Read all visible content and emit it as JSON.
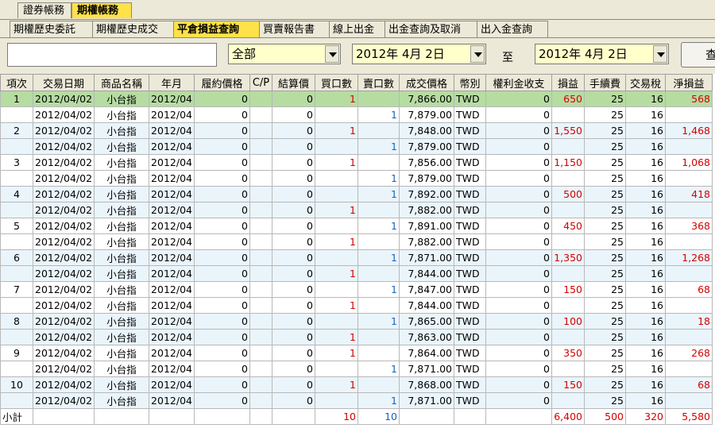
{
  "top_tabs": [
    "證券帳務",
    "期權帳務"
  ],
  "active_top_tab": 1,
  "sub_tabs": [
    "期權歷史委託",
    "期權歷史成交",
    "平倉損益查詢",
    "買賣報告書",
    "線上出金",
    "出金查詢及取消",
    "出入金查詢"
  ],
  "active_sub_tab": 2,
  "filter": {
    "text_value": "",
    "category": "全部",
    "from_date": "2012年 4月 2日",
    "to_label": "至",
    "to_date": "2012年 4月 2日",
    "query_button": "查"
  },
  "columns": [
    "項次",
    "交易日期",
    "商品名稱",
    "年月",
    "履約價格",
    "C/P",
    "結算價",
    "買口數",
    "賣口數",
    "成交價格",
    "幣別",
    "權利金收支",
    "損益",
    "手續費",
    "交易稅",
    "淨損益"
  ],
  "rows": [
    {
      "item": "1",
      "date": "2012/04/02",
      "product": "小台指",
      "ym": "2012/04",
      "strike": "0",
      "cp": "",
      "settle": "0",
      "buy": "1",
      "sell": "",
      "price": "7,866.00",
      "cur": "TWD",
      "premium": "0",
      "pl": "650",
      "fee": "25",
      "tax": "16",
      "net": "568"
    },
    {
      "item": "",
      "date": "2012/04/02",
      "product": "小台指",
      "ym": "2012/04",
      "strike": "0",
      "cp": "",
      "settle": "0",
      "buy": "",
      "sell": "1",
      "price": "7,879.00",
      "cur": "TWD",
      "premium": "0",
      "pl": "",
      "fee": "25",
      "tax": "16",
      "net": ""
    },
    {
      "item": "2",
      "date": "2012/04/02",
      "product": "小台指",
      "ym": "2012/04",
      "strike": "0",
      "cp": "",
      "settle": "0",
      "buy": "1",
      "sell": "",
      "price": "7,848.00",
      "cur": "TWD",
      "premium": "0",
      "pl": "1,550",
      "fee": "25",
      "tax": "16",
      "net": "1,468"
    },
    {
      "item": "",
      "date": "2012/04/02",
      "product": "小台指",
      "ym": "2012/04",
      "strike": "0",
      "cp": "",
      "settle": "0",
      "buy": "",
      "sell": "1",
      "price": "7,879.00",
      "cur": "TWD",
      "premium": "0",
      "pl": "",
      "fee": "25",
      "tax": "16",
      "net": ""
    },
    {
      "item": "3",
      "date": "2012/04/02",
      "product": "小台指",
      "ym": "2012/04",
      "strike": "0",
      "cp": "",
      "settle": "0",
      "buy": "1",
      "sell": "",
      "price": "7,856.00",
      "cur": "TWD",
      "premium": "0",
      "pl": "1,150",
      "fee": "25",
      "tax": "16",
      "net": "1,068"
    },
    {
      "item": "",
      "date": "2012/04/02",
      "product": "小台指",
      "ym": "2012/04",
      "strike": "0",
      "cp": "",
      "settle": "0",
      "buy": "",
      "sell": "1",
      "price": "7,879.00",
      "cur": "TWD",
      "premium": "0",
      "pl": "",
      "fee": "25",
      "tax": "16",
      "net": ""
    },
    {
      "item": "4",
      "date": "2012/04/02",
      "product": "小台指",
      "ym": "2012/04",
      "strike": "0",
      "cp": "",
      "settle": "0",
      "buy": "",
      "sell": "1",
      "price": "7,892.00",
      "cur": "TWD",
      "premium": "0",
      "pl": "500",
      "fee": "25",
      "tax": "16",
      "net": "418"
    },
    {
      "item": "",
      "date": "2012/04/02",
      "product": "小台指",
      "ym": "2012/04",
      "strike": "0",
      "cp": "",
      "settle": "0",
      "buy": "1",
      "sell": "",
      "price": "7,882.00",
      "cur": "TWD",
      "premium": "0",
      "pl": "",
      "fee": "25",
      "tax": "16",
      "net": ""
    },
    {
      "item": "5",
      "date": "2012/04/02",
      "product": "小台指",
      "ym": "2012/04",
      "strike": "0",
      "cp": "",
      "settle": "0",
      "buy": "",
      "sell": "1",
      "price": "7,891.00",
      "cur": "TWD",
      "premium": "0",
      "pl": "450",
      "fee": "25",
      "tax": "16",
      "net": "368"
    },
    {
      "item": "",
      "date": "2012/04/02",
      "product": "小台指",
      "ym": "2012/04",
      "strike": "0",
      "cp": "",
      "settle": "0",
      "buy": "1",
      "sell": "",
      "price": "7,882.00",
      "cur": "TWD",
      "premium": "0",
      "pl": "",
      "fee": "25",
      "tax": "16",
      "net": ""
    },
    {
      "item": "6",
      "date": "2012/04/02",
      "product": "小台指",
      "ym": "2012/04",
      "strike": "0",
      "cp": "",
      "settle": "0",
      "buy": "",
      "sell": "1",
      "price": "7,871.00",
      "cur": "TWD",
      "premium": "0",
      "pl": "1,350",
      "fee": "25",
      "tax": "16",
      "net": "1,268"
    },
    {
      "item": "",
      "date": "2012/04/02",
      "product": "小台指",
      "ym": "2012/04",
      "strike": "0",
      "cp": "",
      "settle": "0",
      "buy": "1",
      "sell": "",
      "price": "7,844.00",
      "cur": "TWD",
      "premium": "0",
      "pl": "",
      "fee": "25",
      "tax": "16",
      "net": ""
    },
    {
      "item": "7",
      "date": "2012/04/02",
      "product": "小台指",
      "ym": "2012/04",
      "strike": "0",
      "cp": "",
      "settle": "0",
      "buy": "",
      "sell": "1",
      "price": "7,847.00",
      "cur": "TWD",
      "premium": "0",
      "pl": "150",
      "fee": "25",
      "tax": "16",
      "net": "68"
    },
    {
      "item": "",
      "date": "2012/04/02",
      "product": "小台指",
      "ym": "2012/04",
      "strike": "0",
      "cp": "",
      "settle": "0",
      "buy": "1",
      "sell": "",
      "price": "7,844.00",
      "cur": "TWD",
      "premium": "0",
      "pl": "",
      "fee": "25",
      "tax": "16",
      "net": ""
    },
    {
      "item": "8",
      "date": "2012/04/02",
      "product": "小台指",
      "ym": "2012/04",
      "strike": "0",
      "cp": "",
      "settle": "0",
      "buy": "",
      "sell": "1",
      "price": "7,865.00",
      "cur": "TWD",
      "premium": "0",
      "pl": "100",
      "fee": "25",
      "tax": "16",
      "net": "18"
    },
    {
      "item": "",
      "date": "2012/04/02",
      "product": "小台指",
      "ym": "2012/04",
      "strike": "0",
      "cp": "",
      "settle": "0",
      "buy": "1",
      "sell": "",
      "price": "7,863.00",
      "cur": "TWD",
      "premium": "0",
      "pl": "",
      "fee": "25",
      "tax": "16",
      "net": ""
    },
    {
      "item": "9",
      "date": "2012/04/02",
      "product": "小台指",
      "ym": "2012/04",
      "strike": "0",
      "cp": "",
      "settle": "0",
      "buy": "1",
      "sell": "",
      "price": "7,864.00",
      "cur": "TWD",
      "premium": "0",
      "pl": "350",
      "fee": "25",
      "tax": "16",
      "net": "268"
    },
    {
      "item": "",
      "date": "2012/04/02",
      "product": "小台指",
      "ym": "2012/04",
      "strike": "0",
      "cp": "",
      "settle": "0",
      "buy": "",
      "sell": "1",
      "price": "7,871.00",
      "cur": "TWD",
      "premium": "0",
      "pl": "",
      "fee": "25",
      "tax": "16",
      "net": ""
    },
    {
      "item": "10",
      "date": "2012/04/02",
      "product": "小台指",
      "ym": "2012/04",
      "strike": "0",
      "cp": "",
      "settle": "0",
      "buy": "1",
      "sell": "",
      "price": "7,868.00",
      "cur": "TWD",
      "premium": "0",
      "pl": "150",
      "fee": "25",
      "tax": "16",
      "net": "68"
    },
    {
      "item": "",
      "date": "2012/04/02",
      "product": "小台指",
      "ym": "2012/04",
      "strike": "0",
      "cp": "",
      "settle": "0",
      "buy": "",
      "sell": "1",
      "price": "7,871.00",
      "cur": "TWD",
      "premium": "0",
      "pl": "",
      "fee": "25",
      "tax": "16",
      "net": ""
    }
  ],
  "subtotal": {
    "label": "小計",
    "buy": "10",
    "sell": "10",
    "pl": "6,400",
    "fee": "500",
    "tax": "320",
    "net": "5,580"
  },
  "colors": {
    "tab_active": "#ffe14a",
    "row_selected": "#b6dca2",
    "row_alt": "#eaf5fb",
    "buy_color": "#d40000",
    "sell_color": "#1565c0",
    "profit_color": "#d40000"
  }
}
